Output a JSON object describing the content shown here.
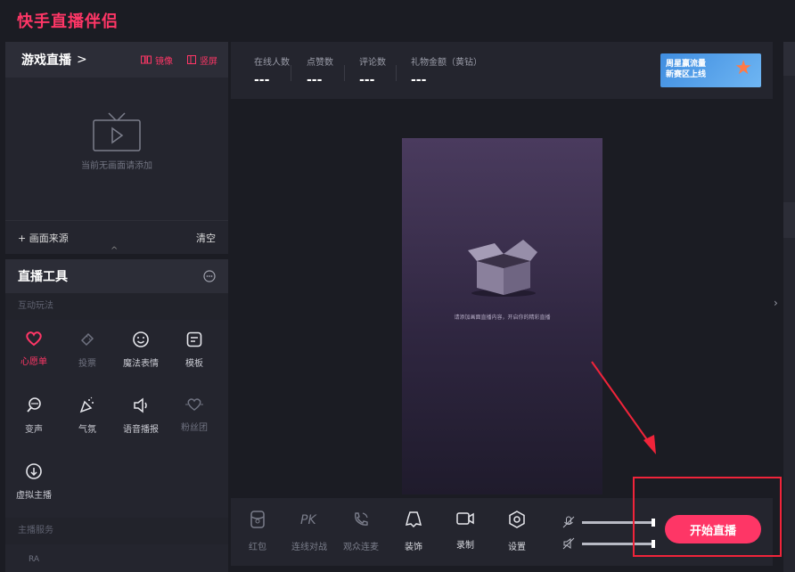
{
  "app": {
    "title": "快手直播伴侣"
  },
  "source_panel": {
    "title": "游戏直播",
    "chevron": ">",
    "mirror_label": "镜像",
    "portrait_label": "竖屏",
    "empty_text": "当前无画面请添加",
    "add_source_label": "+ 画面来源",
    "clear_label": "清空",
    "collapse_glyph": "^"
  },
  "tools_panel": {
    "title": "直播工具",
    "section_interactive": "互动玩法",
    "tools": [
      {
        "label": "心愿单",
        "icon": "heart-icon"
      },
      {
        "label": "投票",
        "icon": "ticket-icon"
      },
      {
        "label": "魔法表情",
        "icon": "smile-icon"
      },
      {
        "label": "模板",
        "icon": "template-icon"
      },
      {
        "label": "变声",
        "icon": "voice-change-icon"
      },
      {
        "label": "气氛",
        "icon": "party-popper-icon"
      },
      {
        "label": "语音播报",
        "icon": "speaker-icon"
      },
      {
        "label": "粉丝团",
        "icon": "fan-club-icon"
      },
      {
        "label": "虚拟主播",
        "icon": "virtual-host-icon"
      }
    ],
    "section_service": "主播服务",
    "partial_label": "RA"
  },
  "stats": {
    "items": [
      {
        "label": "在线人数",
        "value": "---"
      },
      {
        "label": "点赞数",
        "value": "---"
      },
      {
        "label": "评论数",
        "value": "---"
      },
      {
        "label": "礼物金额（黄钻）",
        "value": "---"
      }
    ],
    "banner": {
      "line1": "周星赢流量",
      "line2": "新赛区上线"
    }
  },
  "preview": {
    "hint": "请添加画面直播内容，开启你的精彩直播"
  },
  "bottom_bar": {
    "tools": [
      {
        "label": "红包",
        "icon": "red-packet-icon"
      },
      {
        "label": "连线对战",
        "icon": "pk-icon"
      },
      {
        "label": "观众连麦",
        "icon": "phone-link-icon"
      },
      {
        "label": "装饰",
        "icon": "decoration-icon"
      },
      {
        "label": "录制",
        "icon": "record-icon"
      },
      {
        "label": "设置",
        "icon": "settings-icon"
      }
    ],
    "start_label": "开始直播"
  },
  "colors": {
    "accent": "#fe3666",
    "panel": "#24252e",
    "background": "#1b1c23",
    "annotation": "#f0243a"
  }
}
